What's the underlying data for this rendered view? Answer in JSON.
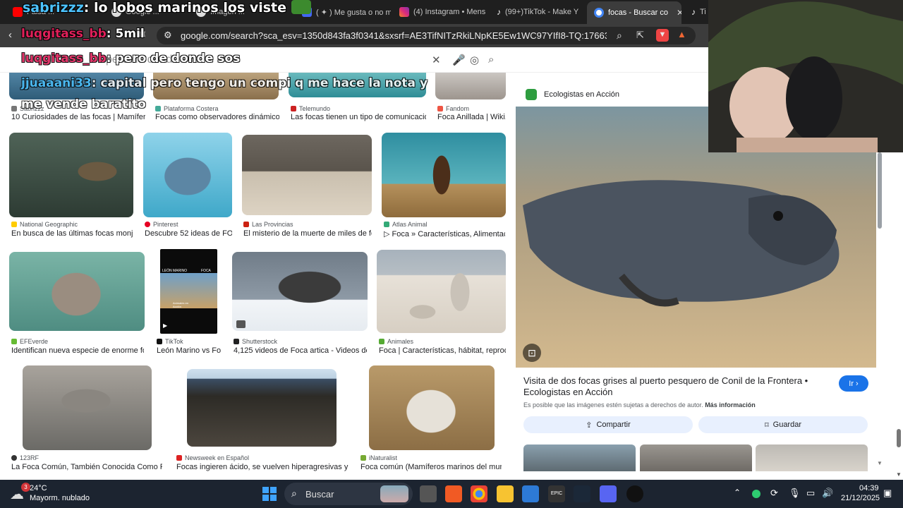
{
  "tabs": [
    {
      "label": "Falsa ... ",
      "active": false
    },
    {
      "label": "Google ... ",
      "active": false
    },
    {
      "label": "Imagen ...",
      "active": false
    },
    {
      "label": "( ✦ ) Me gusta o no m",
      "active": false
    },
    {
      "label": "(4) Instagram • Mens",
      "active": false
    },
    {
      "label": "(99+)TikTok - Make Y",
      "active": false
    },
    {
      "label": "focas - Buscar co",
      "active": true
    },
    {
      "label": "Ti",
      "active": false
    }
  ],
  "address_bar": {
    "url": "google.com/search?sca_esv=1350d843fa3f0341&sxsrf=AE3TifNITzRkiLNpKE5Ew1WC97YIfI8-TQ:1766302748996&ud..."
  },
  "search": {
    "query": "pero de donde sos"
  },
  "overlays": {
    "top_banner_user": "sabrizzz",
    "top_banner_text": "lo lobos marinos los viste",
    "chat_user_1": "luqgitass_bb",
    "chat_msg_1": "5mil",
    "chat_user_2": "luqgitass_bb",
    "chat_msg_2": "pero de donde sos",
    "chat_user_3": "jjuaaani33",
    "chat_msg_3": "capital pero tengo un compi q me hace la nota y",
    "chat_msg_3b": "me vende baratito"
  },
  "results": {
    "row1": [
      {
        "source": "Sabrizzz",
        "caption": "10 Curiosidades de las focas | Mamífero..."
      },
      {
        "source": "Plataforma Costera",
        "caption": "Focas como observadores dinámicos:..."
      },
      {
        "source": "Telemundo",
        "caption": "Las focas tienen un tipo de comunicación ..."
      },
      {
        "source": "Fandom",
        "caption": "Foca Anillada | Wiki..."
      }
    ],
    "row2": [
      {
        "source": "National Geographic",
        "caption": "En busca de las últimas focas monje ..."
      },
      {
        "source": "Pinterest",
        "caption": "Descubre 52 ideas de FO..."
      },
      {
        "source": "Las Provincias",
        "caption": "El misterio de la muerte de miles de foc..."
      },
      {
        "source": "Atlas Animal",
        "caption": "▷ Foca » Características, Alimentaci..."
      }
    ],
    "row3": [
      {
        "source": "EFEverde",
        "caption": "Identifican nueva especie de enorme foc..."
      },
      {
        "source": "TikTok",
        "caption": "León Marino vs Fo..."
      },
      {
        "source": "Shutterstock",
        "caption": "4,125 videos de Foca artica - Videos de s..."
      },
      {
        "source": "Animales",
        "caption": "Foca | Características, hábitat, reprodu..."
      }
    ],
    "row4": [
      {
        "source": "123RF",
        "caption": "La Foca Común, También Conocida Como Foca..."
      },
      {
        "source": "Newsweek en Español",
        "caption": "Focas ingieren ácido, se vuelven hiperagresivas y ata..."
      },
      {
        "source": "iNaturalist",
        "caption": "Foca común (Mamíferos marinos del mundo)..."
      }
    ],
    "tiktok_thumb_text_1": "LEÓN MARINO",
    "tiktok_thumb_text_2": "FOCA",
    "tiktok_thumb_text_3": "Animales en Acción"
  },
  "panel": {
    "source": "Ecologistas en Acción",
    "title": "Visita de dos focas grises al puerto pesquero de Conil de la Frontera • Ecologistas en Acción",
    "go_label": "Ir",
    "notice": "Es posible que las imágenes estén sujetas a derechos de autor.",
    "notice_link": "Más información",
    "share_label": "Compartir",
    "save_label": "Guardar"
  },
  "taskbar": {
    "temp": "24°C",
    "weather": "Mayorm. nublado",
    "weather_badge": "3",
    "search_placeholder": "Buscar",
    "time": "04:39",
    "date": "21/12/2025"
  }
}
